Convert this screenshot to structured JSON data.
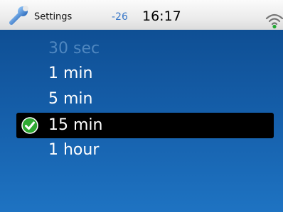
{
  "status_bar": {
    "title": "Settings",
    "signal_value": "-26",
    "time": "16:17",
    "app_icon": "wrench-icon",
    "wifi_icon": "wifi-icon"
  },
  "options": {
    "o0": "30 sec",
    "o1": "1 min",
    "o2": "5 min",
    "selected": "15 min",
    "o4": "1 hour"
  },
  "selected_icon": "check-circle-icon",
  "colors": {
    "accent": "#3a78c8",
    "selection_background": "#000000",
    "check": "#2fa832",
    "list_background": "#155ea9"
  }
}
